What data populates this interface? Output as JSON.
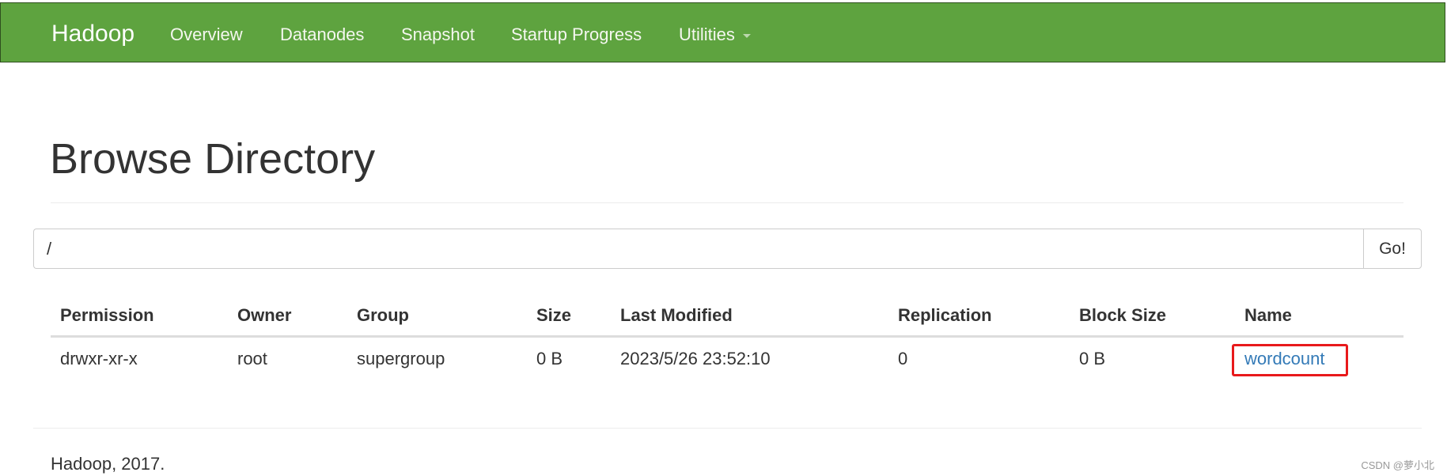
{
  "navbar": {
    "brand": "Hadoop",
    "items": [
      {
        "label": "Overview"
      },
      {
        "label": "Datanodes"
      },
      {
        "label": "Snapshot"
      },
      {
        "label": "Startup Progress"
      },
      {
        "label": "Utilities"
      }
    ],
    "color": "#5ea33f"
  },
  "page": {
    "title": "Browse Directory"
  },
  "path": {
    "value": "/",
    "go_label": "Go!"
  },
  "table": {
    "columns": [
      "Permission",
      "Owner",
      "Group",
      "Size",
      "Last Modified",
      "Replication",
      "Block Size",
      "Name"
    ],
    "rows": [
      [
        "drwxr-xr-x",
        "root",
        "supergroup",
        "0 B",
        "2023/5/26 23:52:10",
        "0",
        "0 B",
        "wordcount"
      ]
    ]
  },
  "highlight": {
    "color": "#e8191b"
  },
  "footer": {
    "text": "Hadoop, 2017."
  },
  "watermark": {
    "text": "CSDN @萝小北"
  }
}
